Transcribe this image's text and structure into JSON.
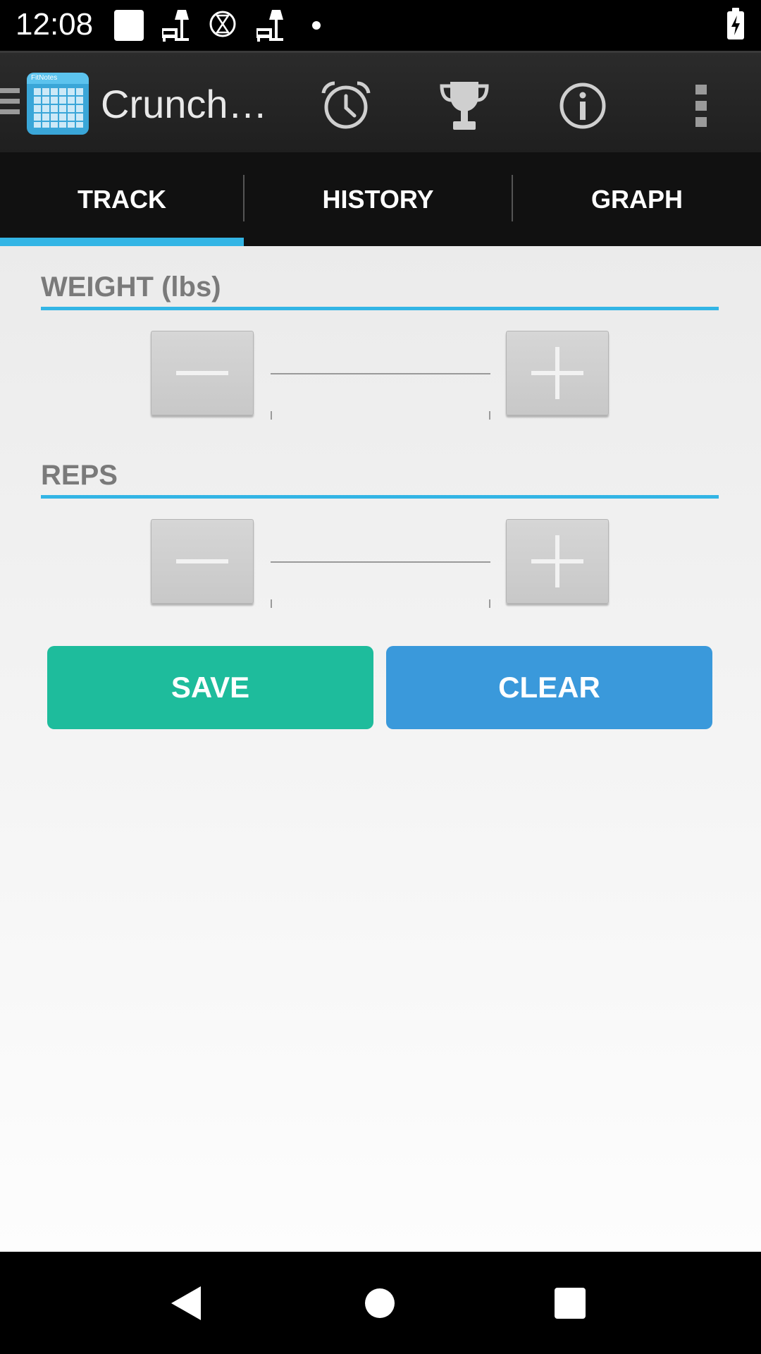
{
  "status_bar": {
    "time": "12:08",
    "icons": [
      "notification-square-icon",
      "lamp-icon",
      "hourglass-icon",
      "lamp-icon",
      "dot-icon",
      "battery-charging-icon"
    ]
  },
  "action_bar": {
    "title": "Crunch…",
    "logo_text": "FitNotes",
    "actions": [
      "alarm-clock-icon",
      "trophy-icon",
      "info-icon",
      "overflow-menu-icon"
    ]
  },
  "tabs": [
    {
      "label": "TRACK",
      "selected": true
    },
    {
      "label": "HISTORY",
      "selected": false
    },
    {
      "label": "GRAPH",
      "selected": false
    }
  ],
  "weight": {
    "label": "WEIGHT (lbs)",
    "value": "",
    "decrement_icon": "minus-icon",
    "increment_icon": "plus-icon"
  },
  "reps": {
    "label": "REPS",
    "value": "",
    "decrement_icon": "minus-icon",
    "increment_icon": "plus-icon"
  },
  "buttons": {
    "save_label": "SAVE",
    "clear_label": "CLEAR"
  },
  "colors": {
    "accent": "#33b5e5",
    "save": "#1ebc9c",
    "clear": "#3a99db"
  },
  "nav_bar": {
    "buttons": [
      "back-icon",
      "home-icon",
      "recents-icon"
    ]
  }
}
